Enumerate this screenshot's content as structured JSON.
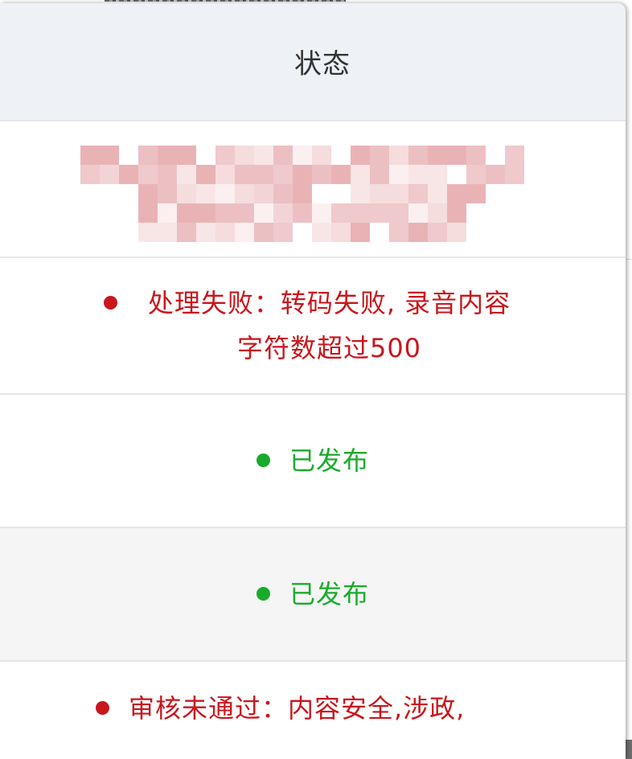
{
  "header": {
    "title": "状态"
  },
  "rows": [
    {
      "type": "redacted"
    },
    {
      "type": "status",
      "state": "fail",
      "color": "#c9161c",
      "text": "处理失败：转码失败, 录音内容字符数超过500"
    },
    {
      "type": "status",
      "state": "ok",
      "color": "#1aab2c",
      "text": "已发布"
    },
    {
      "type": "status",
      "state": "ok",
      "color": "#1aab2c",
      "text": "已发布"
    },
    {
      "type": "status",
      "state": "fail",
      "color": "#c9161c",
      "text": "审核未通过：内容安全,涉政,"
    }
  ],
  "colors": {
    "fail": "#c9161c",
    "ok": "#1aab2c",
    "header_bg": "#eef1f5"
  }
}
